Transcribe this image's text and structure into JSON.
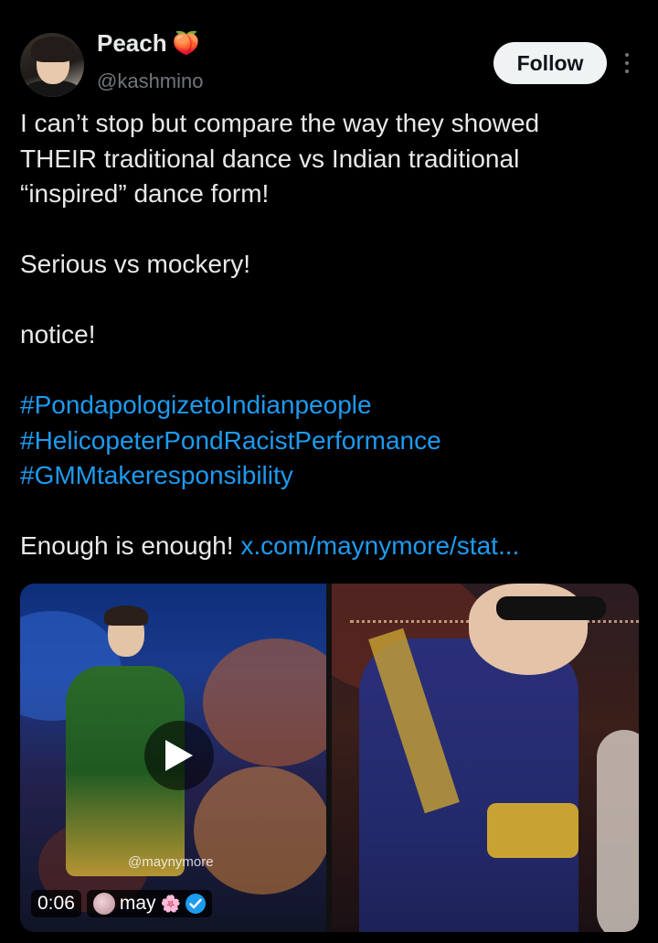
{
  "author": {
    "name": "Peach",
    "emoji": "🍑",
    "handle": "@kashmino"
  },
  "actions": {
    "follow_label": "Follow"
  },
  "tweet": {
    "line1": "I can’t stop but compare the way they showed",
    "line2": "THEIR traditional dance vs Indian traditional",
    "line3": "“inspired” dance form!",
    "line4": "Serious vs mockery!",
    "line5": "notice!",
    "hashtags": [
      "#PondapologizetoIndianpeople",
      "#HelicopeterPondRacistPerformance",
      "#GMMtakeresponsibility"
    ],
    "closing": "Enough is enough! ",
    "link": "x.com/maynymore/stat..."
  },
  "media": {
    "watermark": "@maynymore",
    "duration": "0:06",
    "source_user": "may",
    "source_emoji": "🌸"
  },
  "colors": {
    "background": "#000000",
    "text": "#e7e9ea",
    "secondary": "#71767b",
    "link": "#1d9bf0"
  }
}
